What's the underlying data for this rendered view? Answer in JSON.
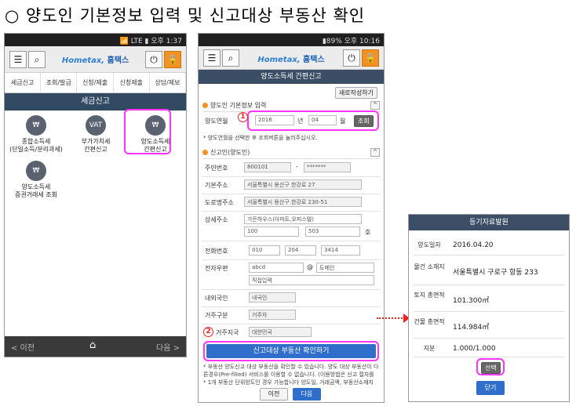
{
  "page_title": "○ 양도인 기본정보 입력 및 신고대상 부동산 확인",
  "phone1": {
    "status": "📶 LTE ▮ 오후 1:37",
    "logo_home": "Hometax,",
    "logo_text": "홈택스",
    "nav": [
      "세금신고",
      "조회/발급",
      "신청/제출",
      "신청제출",
      "상담/제보"
    ],
    "section": "세금신고",
    "tiles": [
      {
        "icon": "₩",
        "label1": "종합소득세",
        "label2": "(단일소득/분리과세)"
      },
      {
        "icon": "VAT",
        "label1": "부가가치세",
        "label2": "간편신고"
      },
      {
        "icon": "₩",
        "label1": "양도소득세",
        "label2": "간편신고"
      },
      {
        "icon": "₩",
        "label1": "양도소득세",
        "label2": "증권거래세 조회"
      }
    ],
    "prev": "< 이전",
    "next": "다음 >"
  },
  "phone2": {
    "status": "▮89% 오후 10:16",
    "logo_home": "Hometax,",
    "logo_text": "홈택스",
    "title": "양도소득세 간편신고",
    "btn_new": "새로작성하기",
    "sec1": "양도인 기본정보 입력",
    "lbl_date": "양도연월",
    "year": "2016",
    "year_unit": "년",
    "month": "04",
    "month_unit": "월",
    "btn_query": "조회",
    "hint1": "* 양도연월을 선택한 후 조회버튼을 눌러주십시오.",
    "sec2": "신고인(양도인)",
    "lbl_rrn": "주민번호",
    "rrn1": "800101",
    "rrn_sep": "-",
    "rrn2": "*******",
    "lbl_addr1": "기본주소",
    "addr1": "서울특별시 용산구 한강로 27",
    "lbl_addr2": "도로명주소",
    "addr2": "서울특별시 용산구 한강로 230-51",
    "lbl_detail": "상세주소",
    "detail1": "가든하우스(아파트,오피스텔)",
    "detail2": "100",
    "detail3": "503",
    "detail_unit": "호",
    "lbl_phone": "전화번호",
    "phone1": "010",
    "phone2": "204",
    "phone3": "3414",
    "lbl_email": "전자우편",
    "email1": "abcd",
    "email_at": "@",
    "email2": "도메인",
    "email_sel": "직접입력",
    "lbl_foreign": "내외국인",
    "foreign": "내국인",
    "lbl_resident": "거주구분",
    "resident": "거주자",
    "lbl_country": "거주지국",
    "country": "대한민국",
    "marker1": "1",
    "marker2": "2",
    "main_btn": "신고대상 부동산 확인하기",
    "note1": "* 부동산 양도신고 대상 부동산을 확인할 수 있습니다. 양도 대상 부동산이 다른경우(Pre-filled) 서비스를 이용할 수 없습니다. (이용방법은 신고 절차를 참고하여 안내를 받아야 신고대상 확인)",
    "note2": "* 1개 부동산 단위양도인 경우 가능합니다 양도일, 거래금액, 부동산소재지 등 기재하여 확인해 주세요.",
    "btn_prev": "이전",
    "btn_next": "다음"
  },
  "dialog": {
    "title": "등기자료발원",
    "rows": [
      {
        "k": "양도일자",
        "v": "2016.04.20"
      },
      {
        "k": "물건 소재지",
        "v": "서울특별시 구로구 항동 233"
      },
      {
        "k": "토지 총면적",
        "v": "101.300㎡"
      },
      {
        "k": "건물 총면적",
        "v": "114.984㎡"
      },
      {
        "k": "지분",
        "v": "1.000/1.000"
      }
    ],
    "select_btn": "선택",
    "close_btn": "닫기"
  }
}
